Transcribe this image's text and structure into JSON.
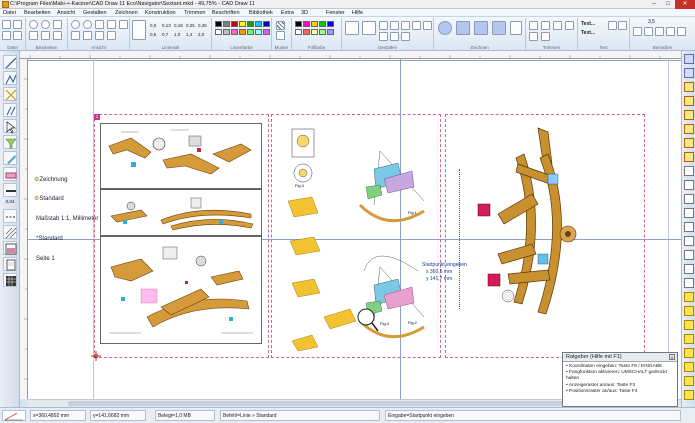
{
  "window": {
    "title": "C:\\Program Files\\Mabi-+-Kaciner\\CAD Draw 11 Eco\\Navigator\\Sextant.mkd - 49,75% - CAD Draw 11",
    "min_label": "–",
    "max_label": "□",
    "close_label": "✕"
  },
  "menu": {
    "items": [
      "Datei",
      "Bearbeiten",
      "Ansicht",
      "Gestalten",
      "Zeichnen",
      "Konstruktion",
      "Trimmen",
      "Beschriften",
      "Bibliothek",
      "Extra",
      "3D",
      "Fenster",
      "Hilfe"
    ]
  },
  "ribbon": {
    "groups": [
      {
        "label": "Datei"
      },
      {
        "label": "Bearbeiten"
      },
      {
        "label": "Ansicht"
      },
      {
        "label": "Linienstil"
      },
      {
        "label": "Linienfarbe"
      },
      {
        "label": "Muster"
      },
      {
        "label": "Füllfarbe"
      },
      {
        "label": "Gestalten"
      },
      {
        "label": "Zeichnen"
      },
      {
        "label": "Trimmen"
      },
      {
        "label": "Text"
      },
      {
        "label": "Bemaßen"
      }
    ],
    "line_widths_row1": [
      "0,0",
      "0,13",
      "0,18",
      "0,25",
      "0,35"
    ],
    "line_widths_row2": [
      "0,5",
      "0,7",
      "1,0",
      "1,4",
      "2,0"
    ],
    "text_buttons": [
      "Text...",
      "Text..."
    ],
    "dim_value": "3,5"
  },
  "left_tool": {
    "line_width": "0,04"
  },
  "canvas": {
    "side_labels": {
      "layer": "Zeichnung",
      "style": "Standard",
      "scale": "Maßstab 1:1, Millimeter",
      "pen": "*Standard",
      "page": "Seite 1"
    },
    "page_number": "1",
    "captions": {
      "fig1": "Fig.1",
      "fig2": "Fig.2",
      "fig3": "Fig.3",
      "fig4": "Fig.4"
    },
    "cursor_info": {
      "line1": "Startpunkt eingeben",
      "line2": "x  360,5 mm",
      "line3": "y  141,7 mm"
    }
  },
  "help": {
    "title": "Ratgeber (Hilfe mit F1)",
    "close": "x",
    "items": [
      "Koordinaten eingeben: Taste F8 / EINGABE",
      "Fangfunktion aktivieren: UMSCHALT gedrückt halten",
      "Anzeigeraster an/aus: Taste F3",
      "Positionsraster an/aus: Taste F4"
    ]
  },
  "status": {
    "x": "x=360,4892 mm",
    "y": "y=141,6682 mm",
    "memory": "Belegt=1,0 MB",
    "command": "Befehl=Linie » Standard",
    "prompt": "Eingabe=Startpunkt eingeben"
  },
  "colors": {
    "accent": "#2b5797",
    "page_border": "#cc6699",
    "wood": "#c8902e"
  }
}
